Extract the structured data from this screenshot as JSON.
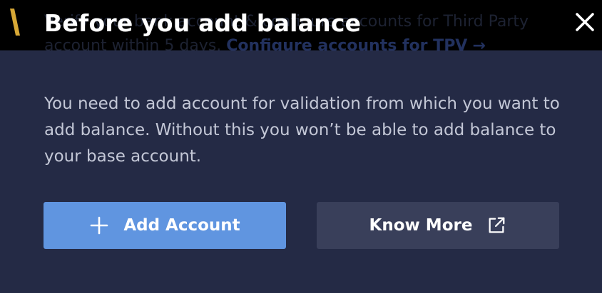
{
  "background": {
    "banner_line1": "Verify your bank account & configure accounts for Third Party",
    "banner_line2": "account within 5 days.",
    "banner_link": "Configure accounts for TPV",
    "banner_arrow": "→"
  },
  "modal": {
    "title": "Before you add balance",
    "message": "You need to add account for validation from which you want to add balance. Without this you won’t be able to add balance to your base account.",
    "primary_button": "Add Account",
    "secondary_button": "Know More"
  },
  "icons": {
    "logo": "brand-logo-icon",
    "close": "close-icon",
    "add": "plus-icon",
    "external": "external-link-icon"
  },
  "colors": {
    "modal_bg": "#242a45",
    "primary": "#6095e0",
    "secondary": "#393f5a",
    "logo": "#d7a836"
  }
}
